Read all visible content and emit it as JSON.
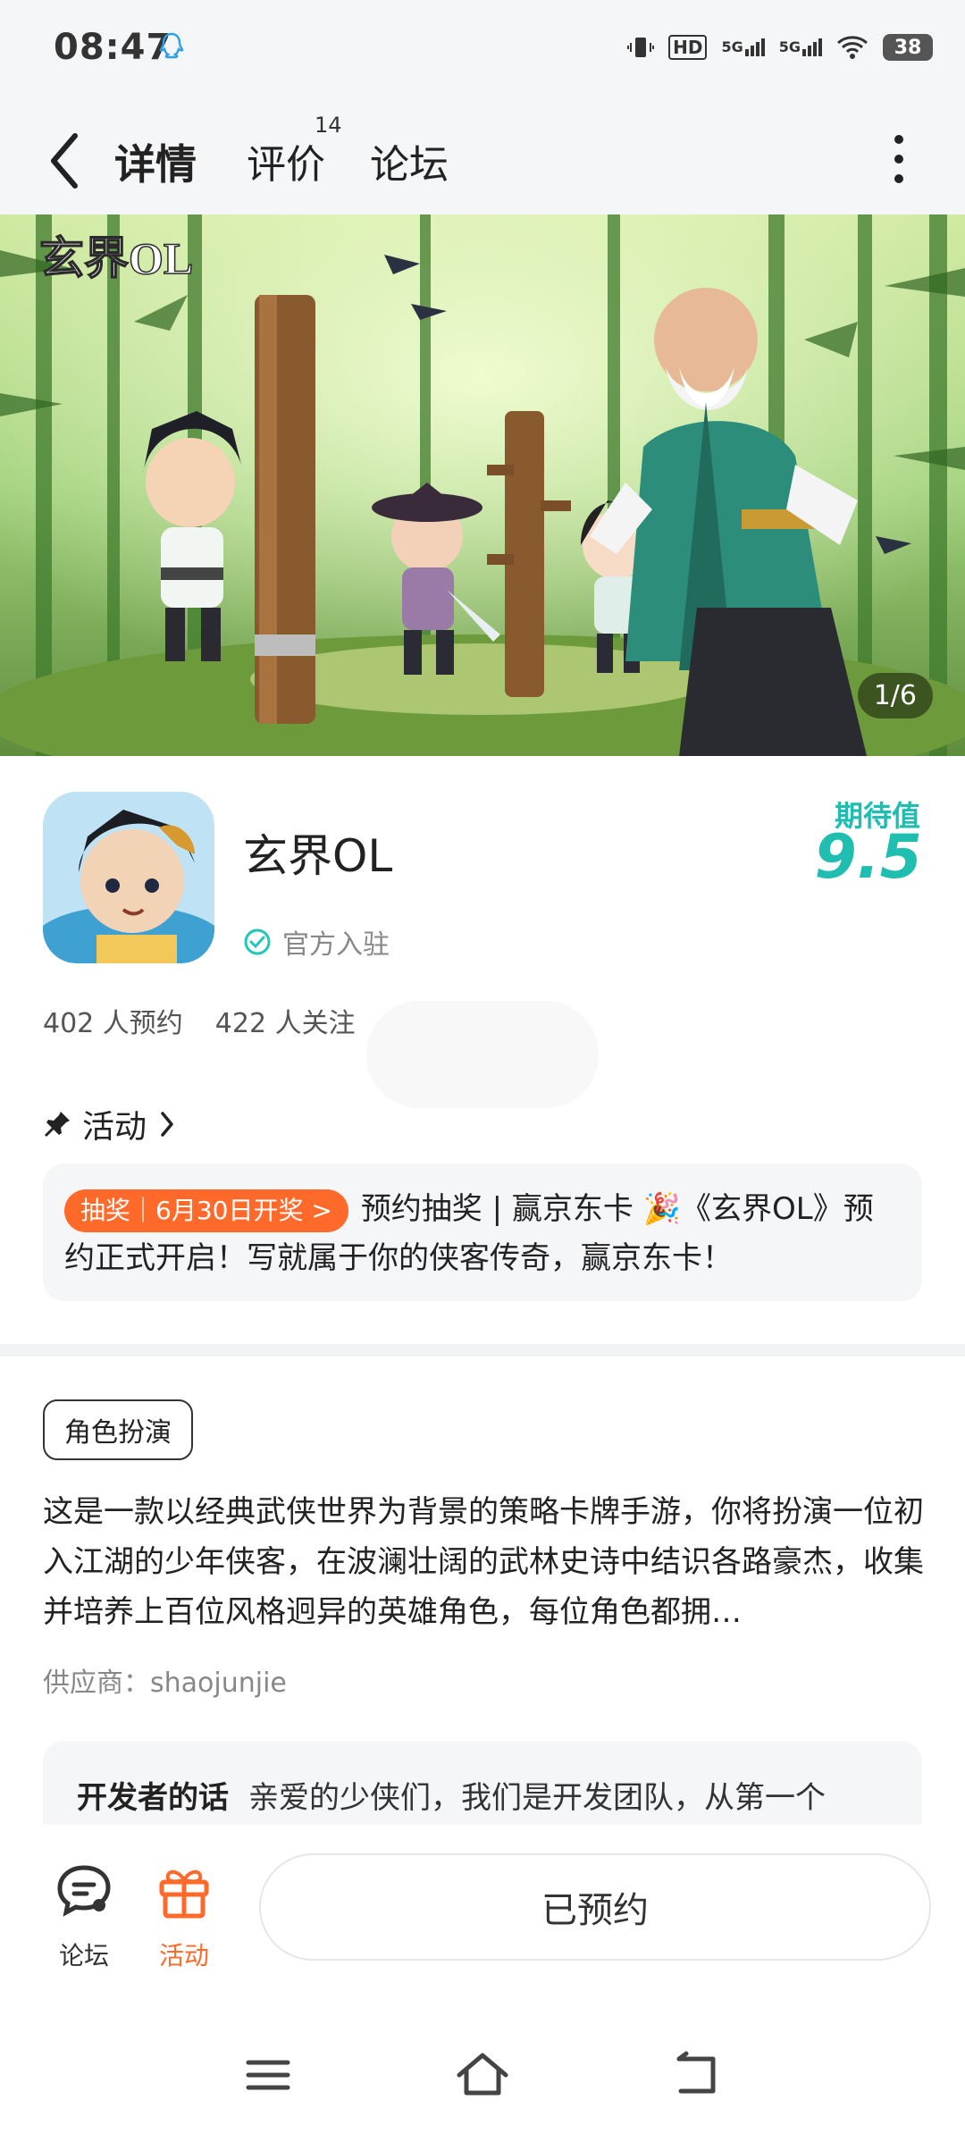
{
  "status_bar": {
    "time": "08:47",
    "network_labels": [
      "HD",
      "5G",
      "5G"
    ],
    "battery": "38"
  },
  "nav": {
    "tabs": [
      {
        "label": "详情",
        "active": true
      },
      {
        "label": "评价",
        "count": "14"
      },
      {
        "label": "论坛"
      }
    ]
  },
  "banner": {
    "logo_text": "玄界OL",
    "pager": "1/6"
  },
  "app": {
    "name": "玄界OL",
    "official": "官方入驻",
    "expect_label": "期待值",
    "expect_value": "9.5",
    "reservations": "402 人预约",
    "followers": "422 人关注"
  },
  "activity": {
    "title": "活动",
    "tag": "抽奖｜6月30日开奖 >",
    "text": "预约抽奖 | 赢京东卡 🎉《玄界OL》预约正式开启！写就属于你的侠客传奇，赢京东卡！"
  },
  "details": {
    "genre": "角色扮演",
    "description": "这是一款以经典武侠世界为背景的策略卡牌手游，你将扮演一位初入江湖的少年侠客，在波澜壮阔的武林史诗中结识各路豪杰，收集并培养上百位风格迥异的英雄角色，每位角色都拥…",
    "supplier": "供应商：shaojunjie",
    "dev_label": "开发者的话",
    "dev_text": "亲爱的少侠们，我们是开发团队，从第一个"
  },
  "bottom_bar": {
    "forum": "论坛",
    "activity": "活动",
    "reserved": "已预约"
  },
  "colors": {
    "accent": "#22c7b7",
    "orange": "#ff6a2b"
  }
}
